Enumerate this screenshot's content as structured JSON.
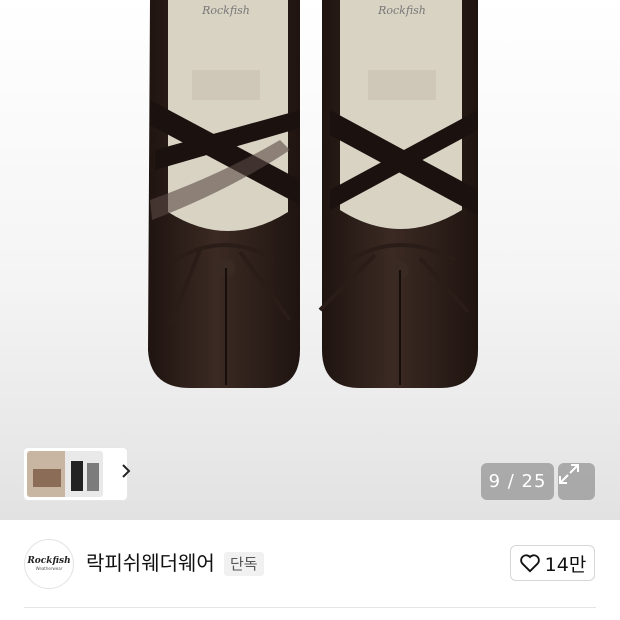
{
  "product_image": {
    "subject": "ballet-flat-product-photo",
    "brand_box_text": "Rockfish",
    "brand_box_subtext": "Weatherwear",
    "colors": {
      "satin": "#2a1c17",
      "satin_highlight": "#5a4038",
      "lining": "#d9d3c4",
      "background_top": "#ffffff",
      "background_bottom": "#e2e2e2"
    }
  },
  "gallery": {
    "counter": "9 / 25",
    "next_icon": "chevron-right-icon",
    "expand_icon": "expand-icon"
  },
  "brand": {
    "logo_text": "Rockfish",
    "logo_subtext": "Weatherwear",
    "name": "락피쉬웨더웨어",
    "badge": "단독",
    "like_icon": "heart-outline-icon",
    "like_count": "14만"
  }
}
